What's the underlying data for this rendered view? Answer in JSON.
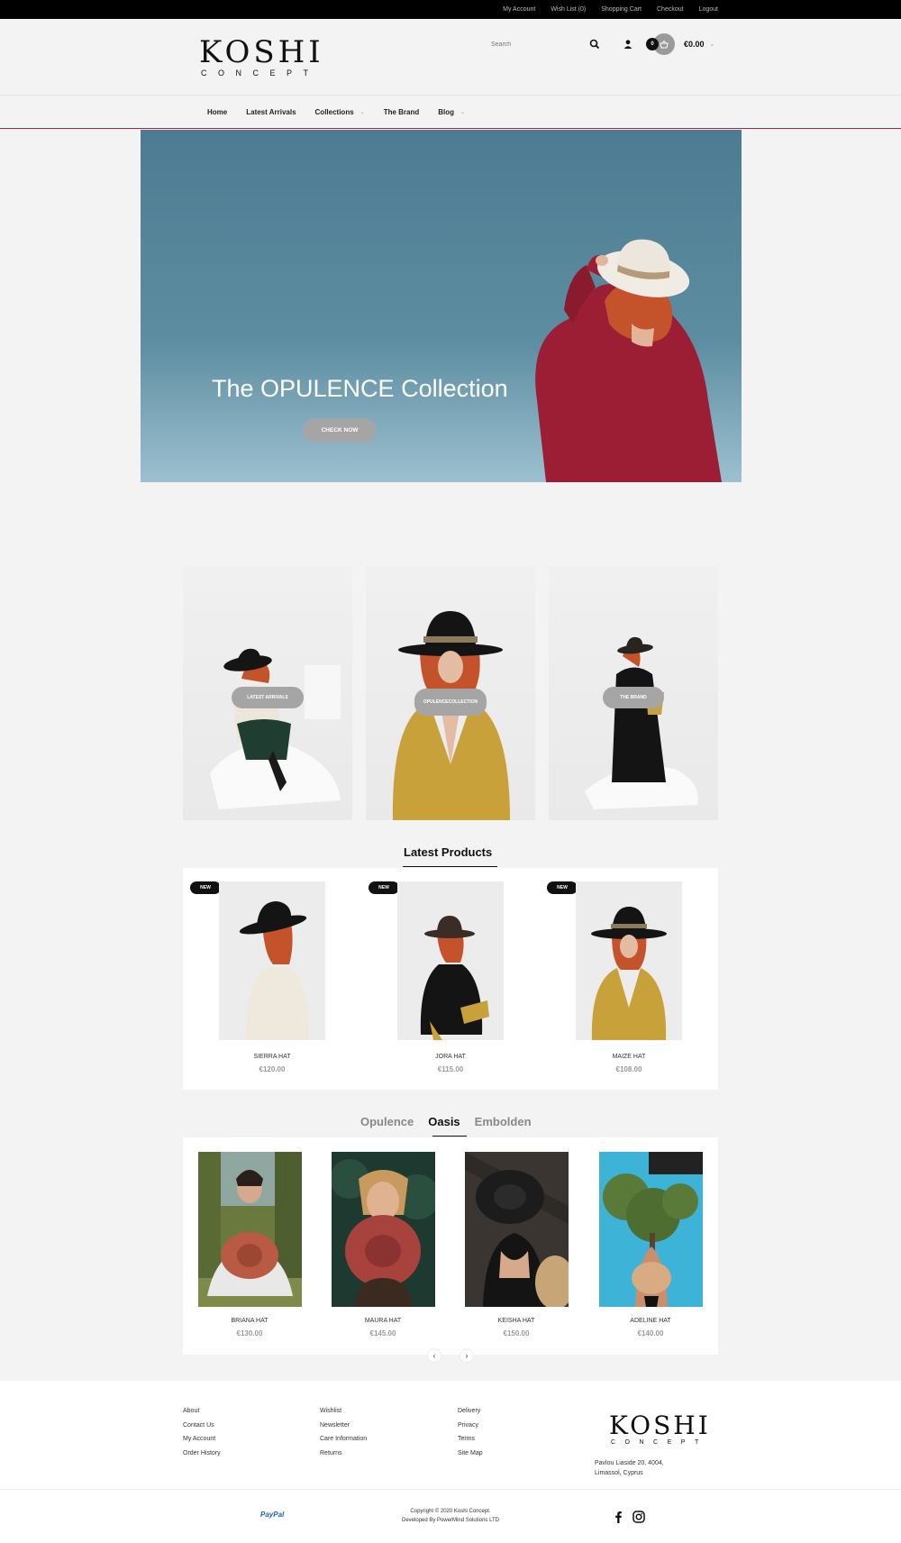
{
  "topbar": {
    "links": [
      "My Account",
      "Wish List (0)",
      "Shopping Cart",
      "Checkout",
      "Logout"
    ]
  },
  "header": {
    "logo_main": "KOSHI",
    "logo_sub": "CONCEPT",
    "search_placeholder": "Search",
    "cart_count": "0",
    "cart_total": "€0.00"
  },
  "nav": {
    "items": [
      {
        "label": "Home",
        "dropdown": false
      },
      {
        "label": "Latest Arrivals",
        "dropdown": false
      },
      {
        "label": "Collections",
        "dropdown": true
      },
      {
        "label": "The Brand",
        "dropdown": false
      },
      {
        "label": "Blog",
        "dropdown": true
      }
    ]
  },
  "hero": {
    "title": "The OPULENCE Collection",
    "button": "CHECK NOW"
  },
  "categories": [
    {
      "label": "LATEST ARRIVALS"
    },
    {
      "label_line1": "OPULENCE",
      "label_line2": "COLLECTION"
    },
    {
      "label": "THE BRAND"
    }
  ],
  "latest": {
    "title": "Latest Products",
    "products": [
      {
        "badge": "NEW",
        "name": "SIERRA HAT",
        "price": "€120.00"
      },
      {
        "badge": "NEW",
        "name": "JORA HAT",
        "price": "€115.00"
      },
      {
        "badge": "NEW",
        "name": "MAIZE HAT",
        "price": "€108.00"
      }
    ]
  },
  "collections": {
    "tabs": [
      "Opulence",
      "Oasis",
      "Embolden"
    ],
    "active_tab": "Oasis",
    "products": [
      {
        "name": "BRIANA HAT",
        "price": "€130.00"
      },
      {
        "name": "MAURA HAT",
        "price": "€145.00"
      },
      {
        "name": "KEISHA HAT",
        "price": "€150.00"
      },
      {
        "name": "ADELINE HAT",
        "price": "€140.00"
      }
    ],
    "prev": "‹",
    "next": "›"
  },
  "footer": {
    "col1": [
      "About",
      "Contact Us",
      "My Account",
      "Order History"
    ],
    "col2": [
      "Wishlist",
      "Newsletter",
      "Care Information",
      "Returns"
    ],
    "col3": [
      "Delivery",
      "Privacy",
      "Terms",
      "Site Map"
    ],
    "logo_main": "KOSHI",
    "logo_sub": "CONCEPT",
    "address_line1": "Pavlou Liaside 20, 4004,",
    "address_line2": "Limassol, Cyprus",
    "payment": "PayPal",
    "copyright_line1": "Copyright © 2020 Koshi Concept.",
    "copyright_line2": "Developed By PowerMind Solutions LTD"
  },
  "colors": {
    "accent": "#a52a3a",
    "button_grey": "#a5a5a5",
    "price_grey": "#999999"
  }
}
